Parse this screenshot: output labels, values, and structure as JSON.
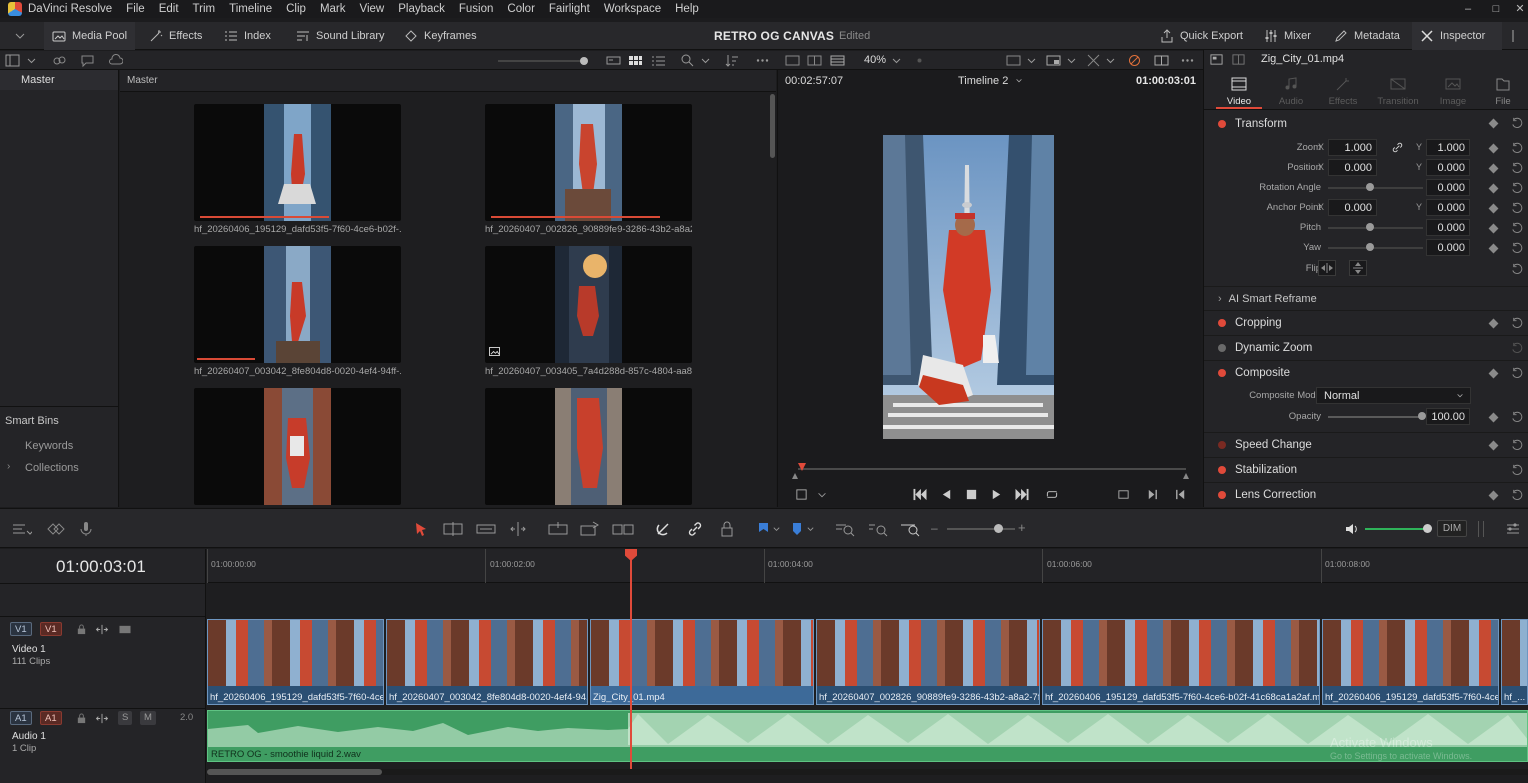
{
  "menu": {
    "app": "DaVinci Resolve",
    "items": [
      "File",
      "Edit",
      "Trim",
      "Timeline",
      "Clip",
      "Mark",
      "View",
      "Playback",
      "Fusion",
      "Color",
      "Fairlight",
      "Workspace",
      "Help"
    ]
  },
  "toolbar": {
    "media_pool": "Media Pool",
    "effects": "Effects",
    "index": "Index",
    "sound_library": "Sound Library",
    "keyframes": "Keyframes",
    "project_title": "RETRO OG CANVAS",
    "project_state": "Edited",
    "quick_export": "Quick Export",
    "mixer": "Mixer",
    "metadata": "Metadata",
    "inspector": "Inspector"
  },
  "viewer_bar": {
    "zoom": "40%",
    "clip_name": "Zig_City_01.mp4"
  },
  "bins": {
    "master_header": "Master",
    "master_item": "Master",
    "smart_bins": "Smart Bins",
    "keywords": "Keywords",
    "collections": "Collections"
  },
  "media_pool": {
    "clips": [
      {
        "label": "hf_20260406_195129_dafd53f5-7f60-4ce6-b02f-...",
        "progress": 0.64
      },
      {
        "label": "hf_20260407_002826_90889fe9-3286-43b2-a8a2...",
        "progress": 0.84
      },
      {
        "label": "hf_20260407_003042_8fe804d8-0020-4ef4-94ff-...",
        "progress": 0.29
      },
      {
        "label": "hf_20260407_003405_7a4d288d-857c-4804-aa8...",
        "progress": 0
      },
      {
        "label": "",
        "progress": 0
      },
      {
        "label": "",
        "progress": 0
      }
    ]
  },
  "viewer": {
    "source_tc": "00:02:57:07",
    "timeline_name": "Timeline 2",
    "record_tc": "01:00:03:01"
  },
  "inspector": {
    "tabs": [
      "Video",
      "Audio",
      "Effects",
      "Transition",
      "Image",
      "File"
    ],
    "transform": "Transform",
    "zoom_label": "Zoom",
    "zoom_x": "1.000",
    "zoom_y": "1.000",
    "position_label": "Position",
    "position_x": "0.000",
    "position_y": "0.000",
    "rotation_label": "Rotation Angle",
    "rotation": "0.000",
    "anchor_label": "Anchor Point",
    "anchor_x": "0.000",
    "anchor_y": "0.000",
    "pitch_label": "Pitch",
    "pitch": "0.000",
    "yaw_label": "Yaw",
    "yaw": "0.000",
    "flip_label": "Flip",
    "x": "X",
    "y": "Y",
    "ai_smart_reframe": "AI Smart Reframe",
    "cropping": "Cropping",
    "dynamic_zoom": "Dynamic Zoom",
    "composite": "Composite",
    "composite_mode_label": "Composite Mode",
    "composite_mode": "Normal",
    "opacity_label": "Opacity",
    "opacity": "100.00",
    "speed_change": "Speed Change",
    "stabilization": "Stabilization",
    "lens_correction": "Lens Correction"
  },
  "timeline": {
    "timecode": "01:00:03:01",
    "ruler": [
      "01:00:00:00",
      "01:00:02:00",
      "01:00:04:00",
      "01:00:06:00",
      "01:00:08:00"
    ],
    "dim": "DIM",
    "v1_name": "Video 1",
    "v1_count": "111 Clips",
    "a1_name": "Audio 1",
    "a1_count": "1 Clip",
    "a1_level": "2.0",
    "badge_v1": "V1",
    "badge_a1": "A1",
    "s": "S",
    "m": "M",
    "clips": [
      "hf_20260406_195129_dafd53f5-7f60-4ce...",
      "hf_20260407_003042_8fe804d8-0020-4ef4-94...",
      "Zig_City_01.mp4",
      "hf_20260407_002826_90889fe9-3286-43b2-a8a2-7f...",
      "hf_20260406_195129_dafd53f5-7f60-4ce6-b02f-41c68ca1a2af.m...",
      "hf_20260406_195129_dafd53f5-7f60-4ce...",
      "hf_..."
    ],
    "audio_clip": "RETRO OG  - smoothie liquid 2.wav",
    "watermark_1": "Activate Windows",
    "watermark_2": "Go to Settings to activate Windows."
  }
}
